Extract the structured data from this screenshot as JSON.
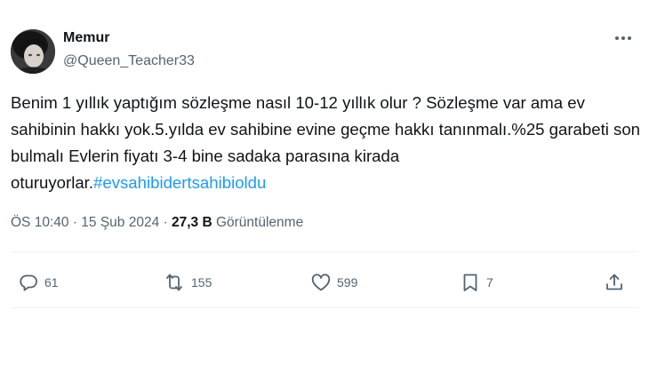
{
  "author": {
    "name": "Memur",
    "handle": "@Queen_Teacher33"
  },
  "tweet": {
    "text": "Benim 1 yıllık yaptığım sözleşme nasıl 10-12 yıllık olur ? Sözleşme var ama ev sahibinin hakkı yok.5.yılda ev sahibine evine geçme hakkı tanınmalı.%25 garabeti son bulmalı Evlerin fiyatı 3-4 bine sadaka parasına kirada oturuyorlar.",
    "hashtag": "#evsahibidertsahibioldu"
  },
  "meta": {
    "time": "ÖS 10:40",
    "separator": " · ",
    "date": "15 Şub 2024",
    "views_count": "27,3 B",
    "views_label": " Görüntülenme"
  },
  "actions": {
    "replies": "61",
    "retweets": "155",
    "likes": "599",
    "bookmarks": "7"
  },
  "icons": {
    "more": "more-icon",
    "reply": "reply-icon",
    "retweet": "retweet-icon",
    "like": "heart-icon",
    "bookmark": "bookmark-icon",
    "share": "share-icon"
  },
  "colors": {
    "text": "#0f1419",
    "secondary": "#536471",
    "link": "#1d9bf0",
    "divider": "#eff3f4"
  }
}
